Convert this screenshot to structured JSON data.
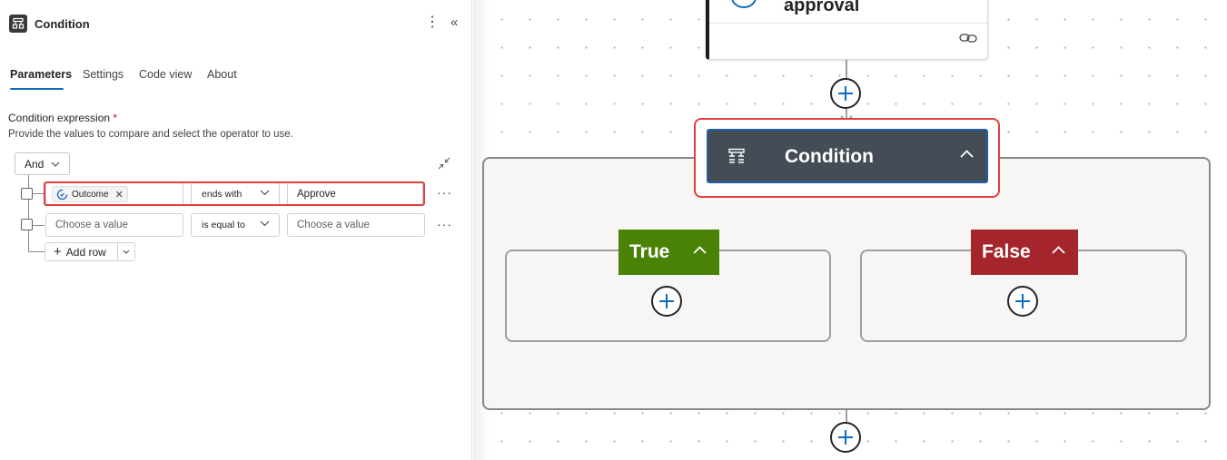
{
  "panel": {
    "title": "Condition",
    "tabs": [
      {
        "label": "Parameters",
        "active": true
      },
      {
        "label": "Settings"
      },
      {
        "label": "Code view"
      },
      {
        "label": "About"
      }
    ],
    "field_label": "Condition expression",
    "required_mark": "*",
    "description": "Provide the values to compare and select the operator to use.",
    "group_operator": "And",
    "rows": [
      {
        "left_token": "Outcome",
        "operator": "ends with",
        "right_value": "Approve"
      },
      {
        "left_placeholder": "Choose a value",
        "operator": "is equal to",
        "right_placeholder": "Choose a value"
      }
    ],
    "add_row_label": "Add row",
    "more_glyph": "···"
  },
  "canvas": {
    "approval_title": "approval",
    "condition_title": "Condition",
    "true_label": "True",
    "false_label": "False"
  },
  "colors": {
    "accent": "#0f6cbd",
    "highlight": "#e0403c",
    "true_branch": "#498205",
    "false_branch": "#a4262c",
    "condition_card": "#444c56"
  }
}
